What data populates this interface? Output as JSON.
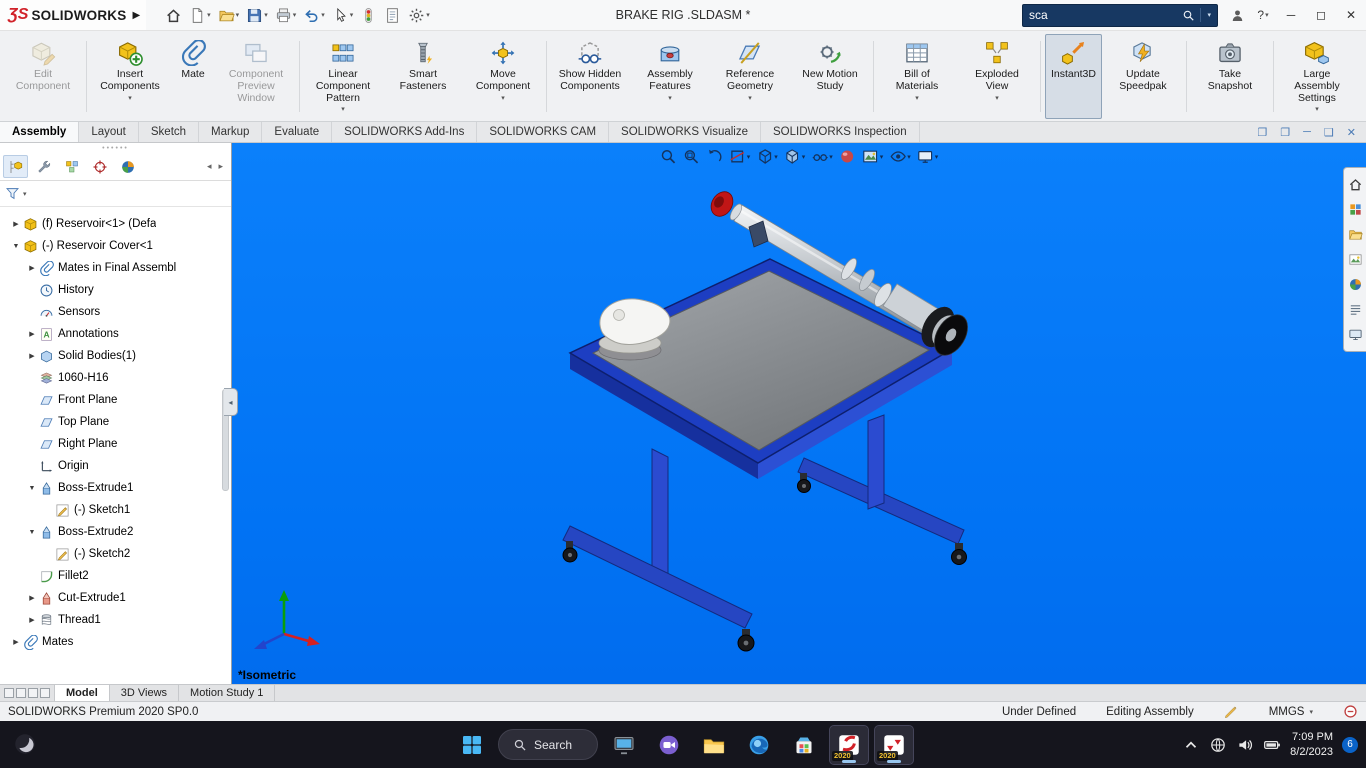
{
  "titlebar": {
    "brand": "SOLIDWORKS",
    "doc_title": "BRAKE RIG .SLDASM *",
    "search_value": "sca",
    "quick_access": [
      {
        "icon": "home",
        "dropdown": false
      },
      {
        "icon": "new-document",
        "dropdown": true
      },
      {
        "icon": "open",
        "dropdown": true
      },
      {
        "icon": "save",
        "dropdown": true
      },
      {
        "icon": "print",
        "dropdown": true
      },
      {
        "icon": "undo",
        "dropdown": true
      },
      {
        "icon": "select",
        "dropdown": true
      },
      {
        "icon": "rebuild",
        "dropdown": false
      },
      {
        "icon": "file-properties",
        "dropdown": false
      },
      {
        "icon": "options",
        "dropdown": true
      }
    ]
  },
  "command_tabs": [
    {
      "label": "Assembly",
      "active": true
    },
    {
      "label": "Layout"
    },
    {
      "label": "Sketch"
    },
    {
      "label": "Markup"
    },
    {
      "label": "Evaluate"
    },
    {
      "label": "SOLIDWORKS Add-Ins"
    },
    {
      "label": "SOLIDWORKS CAM"
    },
    {
      "label": "SOLIDWORKS Visualize"
    },
    {
      "label": "SOLIDWORKS Inspection"
    }
  ],
  "ribbon": [
    {
      "label": "Edit Component",
      "icon": "edit-component",
      "disabled": true
    },
    {
      "sep": true
    },
    {
      "label": "Insert Components",
      "icon": "insert-components",
      "dropdown": true
    },
    {
      "label": "Mate",
      "icon": "mate"
    },
    {
      "label": "Component Preview Window",
      "icon": "component-preview-window",
      "disabled": true
    },
    {
      "sep": true
    },
    {
      "label": "Linear Component Pattern",
      "icon": "linear-component-pattern",
      "dropdown": true
    },
    {
      "label": "Smart Fasteners",
      "icon": "smart-fasteners"
    },
    {
      "label": "Move Component",
      "icon": "move-component",
      "dropdown": true
    },
    {
      "sep": true
    },
    {
      "label": "Show Hidden Components",
      "icon": "show-hidden-components"
    },
    {
      "label": "Assembly Features",
      "icon": "assembly-features",
      "dropdown": true
    },
    {
      "label": "Reference Geometry",
      "icon": "reference-geometry",
      "dropdown": true
    },
    {
      "label": "New Motion Study",
      "icon": "new-motion-study"
    },
    {
      "sep": true
    },
    {
      "label": "Bill of Materials",
      "icon": "bill-of-materials",
      "dropdown": true
    },
    {
      "label": "Exploded View",
      "icon": "exploded-view",
      "dropdown": true
    },
    {
      "sep": true
    },
    {
      "label": "Instant3D",
      "icon": "instant3d",
      "active": true
    },
    {
      "label": "Update Speedpak",
      "icon": "update-speedpak"
    },
    {
      "sep": true
    },
    {
      "label": "Take Snapshot",
      "icon": "take-snapshot"
    },
    {
      "sep": true
    },
    {
      "label": "Large Assembly Settings",
      "icon": "large-assembly-settings",
      "dropdown": true
    }
  ],
  "feature_manager": {
    "tabs": [
      "feature-manager",
      "property-manager",
      "configuration-manager",
      "dimxpert-manager",
      "display-manager"
    ],
    "items": [
      {
        "label": "(f) Reservoir<1> (Defa",
        "level": 0,
        "expand": "collapsed",
        "icon": "part"
      },
      {
        "label": "(-) Reservoir Cover<1",
        "level": 0,
        "expand": "expanded",
        "icon": "part"
      },
      {
        "label": "Mates in Final Assembl",
        "level": 1,
        "expand": "collapsed",
        "icon": "mates"
      },
      {
        "label": "History",
        "level": 1,
        "icon": "history"
      },
      {
        "label": "Sensors",
        "level": 1,
        "icon": "sensors"
      },
      {
        "label": "Annotations",
        "level": 1,
        "expand": "collapsed",
        "icon": "annotations"
      },
      {
        "label": "Solid Bodies(1)",
        "level": 1,
        "expand": "collapsed",
        "icon": "solid-bodies"
      },
      {
        "label": "1060-H16",
        "level": 1,
        "icon": "material"
      },
      {
        "label": "Front Plane",
        "level": 1,
        "icon": "plane"
      },
      {
        "label": "Top Plane",
        "level": 1,
        "icon": "plane"
      },
      {
        "label": "Right Plane",
        "level": 1,
        "icon": "plane"
      },
      {
        "label": "Origin",
        "level": 1,
        "icon": "origin"
      },
      {
        "label": "Boss-Extrude1",
        "level": 1,
        "expand": "expanded",
        "icon": "boss-extrude"
      },
      {
        "label": "(-) Sketch1",
        "level": 2,
        "icon": "sketch"
      },
      {
        "label": "Boss-Extrude2",
        "level": 1,
        "expand": "expanded",
        "icon": "boss-extrude"
      },
      {
        "label": "(-) Sketch2",
        "level": 2,
        "icon": "sketch"
      },
      {
        "label": "Fillet2",
        "level": 1,
        "icon": "fillet"
      },
      {
        "label": "Cut-Extrude1",
        "level": 1,
        "expand": "collapsed",
        "icon": "cut-extrude"
      },
      {
        "label": "Thread1",
        "level": 1,
        "expand": "collapsed",
        "icon": "thread"
      },
      {
        "label": "Mates",
        "level": 0,
        "expand": "collapsed",
        "icon": "mates"
      }
    ]
  },
  "viewport": {
    "view_label": "*Isometric",
    "heads_up": [
      {
        "icon": "zoom-to-fit"
      },
      {
        "icon": "zoom-to-area"
      },
      {
        "icon": "previous-view"
      },
      {
        "icon": "section-view",
        "dropdown": true
      },
      {
        "icon": "view-orientation",
        "dropdown": true
      },
      {
        "icon": "display-style",
        "dropdown": true
      },
      {
        "icon": "hide-show-items",
        "dropdown": true
      },
      {
        "icon": "edit-appearance"
      },
      {
        "icon": "apply-scene",
        "dropdown": true
      },
      {
        "icon": "view-settings",
        "dropdown": true
      },
      {
        "icon": "screen-display",
        "dropdown": true
      }
    ],
    "task_pane": [
      "solidworks-resources",
      "design-library",
      "file-explorer",
      "view-palette",
      "appearances-scenes",
      "custom-properties",
      "screen-capture"
    ]
  },
  "document_tabs": [
    {
      "label": "Model",
      "active": true
    },
    {
      "label": "3D Views"
    },
    {
      "label": "Motion Study 1"
    }
  ],
  "statusbar": {
    "product": "SOLIDWORKS Premium 2020 SP0.0",
    "constraint_status": "Under Defined",
    "mode": "Editing Assembly",
    "units": "MMGS"
  },
  "taskbar": {
    "search_label": "Search",
    "apps": [
      {
        "icon": "desktop-app"
      },
      {
        "icon": "meet-now"
      },
      {
        "icon": "file-explorer-app"
      },
      {
        "icon": "edge-browser"
      },
      {
        "icon": "microsoft-store"
      },
      {
        "icon": "solidworks-2020",
        "badge": "2020",
        "active": true
      },
      {
        "icon": "edrawings-2020",
        "badge": "2020",
        "active": true
      }
    ],
    "clock": {
      "time": "7:09 PM",
      "date": "8/2/2023"
    },
    "notification_count": "6"
  }
}
